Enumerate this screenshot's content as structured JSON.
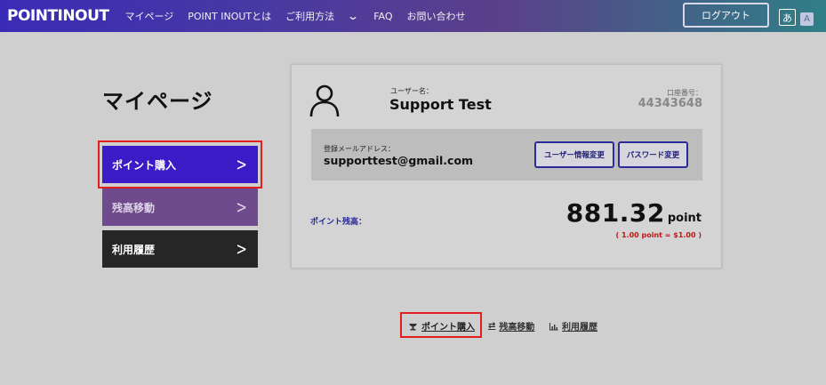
{
  "header": {
    "logo": "POINTINOUT",
    "nav": [
      "マイページ",
      "POINT INOUTとは",
      "ご利用方法",
      "FAQ",
      "お問い合わせ"
    ],
    "logout_label": "ログアウト",
    "lang_ja": "あ",
    "lang_en": "A"
  },
  "page": {
    "title": "マイページ"
  },
  "sidebar": {
    "items": [
      {
        "label": "ポイント購入"
      },
      {
        "label": "残高移動"
      },
      {
        "label": "利用履歴"
      }
    ]
  },
  "account": {
    "username_label": "ユーザー名：",
    "username": "Support Test",
    "account_number_label": "口座番号：",
    "account_number": "44343648",
    "email_label": "登録メールアドレス：",
    "email": "supporttest@gmail.com",
    "edit_user_label": "ユーザー情報変更",
    "edit_password_label": "パスワード変更",
    "balance_label": "ポイント残高：",
    "balance_value": "881.32",
    "balance_unit": "point",
    "rate_text": "( 1.00 point = $1.00 )"
  },
  "bottom_links": [
    {
      "label": "ポイント購入",
      "icon": "piggy-bank-icon"
    },
    {
      "label": "残高移動",
      "icon": "transfer-arrows-icon"
    },
    {
      "label": "利用履歴",
      "icon": "bar-chart-icon"
    }
  ],
  "colors": {
    "highlight": "#e0201e",
    "primary": "#3a1bc6",
    "rate_red": "#c01616"
  }
}
